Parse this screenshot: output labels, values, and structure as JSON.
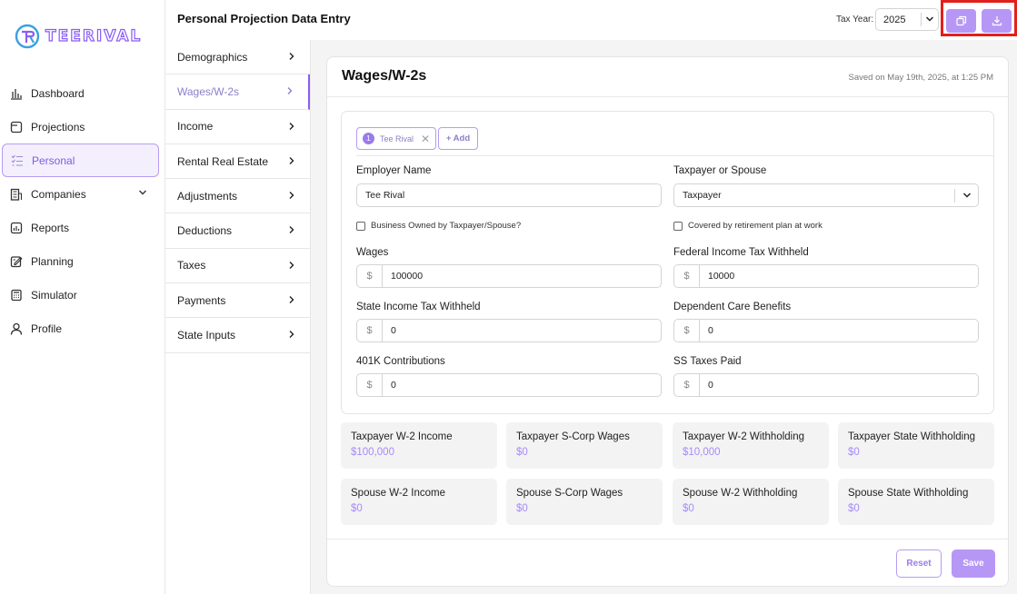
{
  "app": {
    "logo_text": "TEERIVAL"
  },
  "sidebar": {
    "items": [
      {
        "label": "Dashboard",
        "icon": "bar-chart-icon"
      },
      {
        "label": "Projections",
        "icon": "folder-icon"
      },
      {
        "label": "Personal",
        "icon": "checklist-icon",
        "active": true
      },
      {
        "label": "Companies",
        "icon": "building-icon",
        "has_chevron": true
      },
      {
        "label": "Reports",
        "icon": "report-icon"
      },
      {
        "label": "Planning",
        "icon": "edit-icon"
      },
      {
        "label": "Simulator",
        "icon": "calculator-icon"
      },
      {
        "label": "Profile",
        "icon": "user-icon"
      }
    ]
  },
  "header": {
    "title": "Personal Projection Data Entry",
    "tax_year_label": "Tax Year:",
    "tax_year_value": "2025",
    "copy_icon": "copy-icon",
    "download_icon": "download-icon"
  },
  "subnav": {
    "items": [
      {
        "label": "Demographics"
      },
      {
        "label": "Wages/W-2s",
        "active": true
      },
      {
        "label": "Income"
      },
      {
        "label": "Rental Real Estate"
      },
      {
        "label": "Adjustments"
      },
      {
        "label": "Deductions"
      },
      {
        "label": "Taxes"
      },
      {
        "label": "Payments"
      },
      {
        "label": "State Inputs"
      }
    ]
  },
  "main": {
    "title": "Wages/W-2s",
    "saved_text": "Saved on May 19th, 2025, at 1:25 PM",
    "chip": {
      "number": "1",
      "label": "Tee Rival"
    },
    "add_label": "+ Add",
    "form": {
      "employer_name_label": "Employer Name",
      "employer_name_value": "Tee Rival",
      "taxpayer_spouse_label": "Taxpayer or Spouse",
      "taxpayer_spouse_value": "Taxpayer",
      "business_owned_label": "Business Owned by Taxpayer/Spouse?",
      "retirement_plan_label": "Covered by retirement plan at work",
      "currency_symbol": "$",
      "wages_label": "Wages",
      "wages_value": "100000",
      "federal_withheld_label": "Federal Income Tax Withheld",
      "federal_withheld_value": "10000",
      "state_withheld_label": "State Income Tax Withheld",
      "state_withheld_value": "0",
      "dependent_care_label": "Dependent Care Benefits",
      "dependent_care_value": "0",
      "k401_label": "401K Contributions",
      "k401_value": "0",
      "ss_taxes_label": "SS Taxes Paid",
      "ss_taxes_value": "0"
    },
    "summary": [
      {
        "label": "Taxpayer W-2 Income",
        "value": "$100,000"
      },
      {
        "label": "Taxpayer S-Corp Wages",
        "value": "$0"
      },
      {
        "label": "Taxpayer W-2 Withholding",
        "value": "$10,000"
      },
      {
        "label": "Taxpayer State Withholding",
        "value": "$0"
      },
      {
        "label": "Spouse W-2 Income",
        "value": "$0"
      },
      {
        "label": "Spouse S-Corp Wages",
        "value": "$0"
      },
      {
        "label": "Spouse W-2 Withholding",
        "value": "$0"
      },
      {
        "label": "Spouse State Withholding",
        "value": "$0"
      }
    ],
    "reset_label": "Reset",
    "save_label": "Save"
  },
  "colors": {
    "accent": "#8b5cf6",
    "accent_light": "#b797f6",
    "highlight_frame": "#e0201b"
  }
}
